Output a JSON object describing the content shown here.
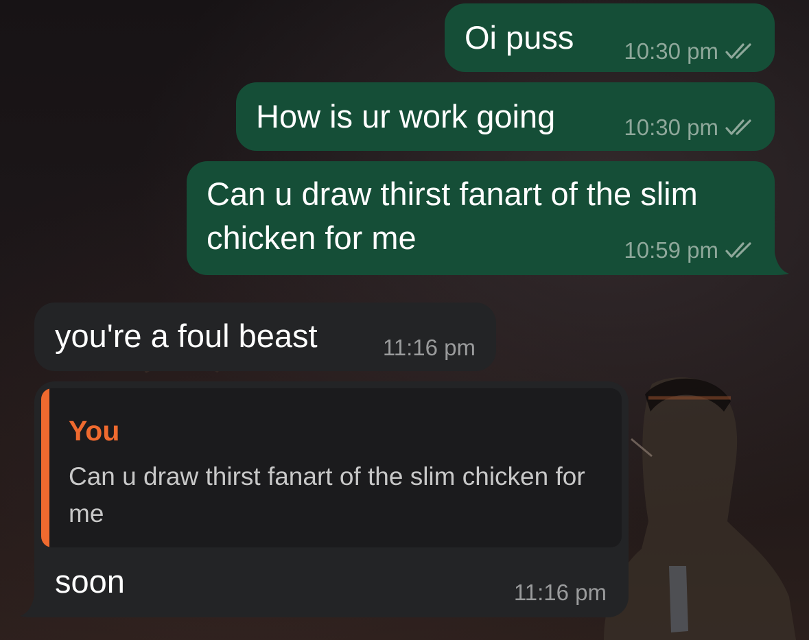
{
  "messages": [
    {
      "id": "m1",
      "direction": "outgoing",
      "text": "Oi puss",
      "time": "10:30 pm",
      "status": "read-double-check"
    },
    {
      "id": "m2",
      "direction": "outgoing",
      "text": "How is ur work going",
      "time": "10:30 pm",
      "status": "read-double-check"
    },
    {
      "id": "m3",
      "direction": "outgoing",
      "text": "Can u draw thirst fanart of the slim chicken for me",
      "time": "10:59 pm",
      "status": "read-double-check"
    },
    {
      "id": "m4",
      "direction": "incoming",
      "text": "you're a foul beast",
      "time": "11:16 pm"
    },
    {
      "id": "m5",
      "direction": "incoming",
      "text": "soon",
      "time": "11:16 pm",
      "reply_to": {
        "author": "You",
        "text": "Can u draw thirst fanart of the slim chicken for me"
      }
    }
  ],
  "icons": {
    "read_status": "double-check-icon"
  },
  "colors": {
    "outgoing_bubble": "#154e37",
    "incoming_bubble": "#232426",
    "quote_accent": "#ef6a2f",
    "background": "#141112"
  }
}
